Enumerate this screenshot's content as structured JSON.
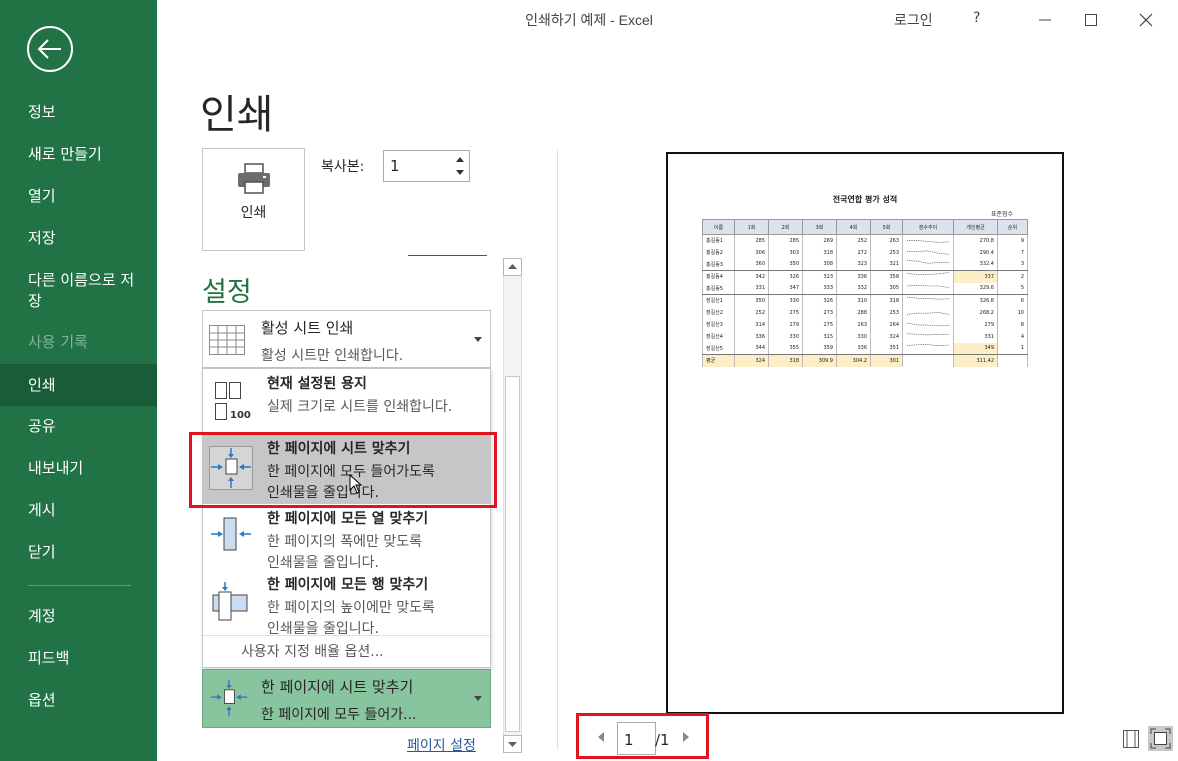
{
  "window": {
    "title": "인쇄하기 예제  -  Excel",
    "login_label": "로그인",
    "help_label": "?"
  },
  "sidebar": {
    "items": [
      {
        "label": "정보"
      },
      {
        "label": "새로 만들기"
      },
      {
        "label": "열기"
      },
      {
        "label": "저장"
      },
      {
        "label": "다른 이름으로 저장"
      },
      {
        "label": "사용 기록"
      },
      {
        "label": "인쇄"
      },
      {
        "label": "공유"
      },
      {
        "label": "내보내기"
      },
      {
        "label": "게시"
      },
      {
        "label": "닫기"
      },
      {
        "label": "계정"
      },
      {
        "label": "피드백"
      },
      {
        "label": "옵션"
      }
    ]
  },
  "print": {
    "heading": "인쇄",
    "button_label": "인쇄",
    "copies_label": "복사본:",
    "copies_value": "1"
  },
  "settings": {
    "heading": "설정",
    "sheet_dropdown": {
      "main": "활성 시트 인쇄",
      "sub": "활성 시트만 인쇄합니다."
    },
    "menu": {
      "items": [
        {
          "title": "현재 설정된 용지",
          "desc1": "실제 크기로 시트를 인쇄합니다.",
          "desc2": "",
          "icon_label": "100"
        },
        {
          "title": "한 페이지에 시트 맞추기",
          "desc1": "한 페이지에 모두 들어가도록",
          "desc2": "인쇄물을 줄입니다."
        },
        {
          "title": "한 페이지에 모든 열 맞추기",
          "desc1": "한 페이지의 폭에만 맞도록",
          "desc2": "인쇄물을 줄입니다."
        },
        {
          "title": "한 페이지에 모든 행 맞추기",
          "desc1": "한 페이지의 높이에만 맞도록",
          "desc2": "인쇄물을 줄입니다."
        }
      ],
      "custom_label": "사용자 지정 배율 옵션..."
    },
    "scale_dropdown": {
      "main": "한 페이지에 시트 맞추기",
      "sub": "한 페이지에 모두 들어가..."
    },
    "page_setup_link": "페이지 설정"
  },
  "preview": {
    "title": "전국연합 평가 성적",
    "unit_label": "표준점수",
    "headers": [
      "이름",
      "1회",
      "2회",
      "3회",
      "4회",
      "5회",
      "점수추이",
      "개인평균",
      "순위"
    ],
    "rows": [
      {
        "name": "홍길동1",
        "s1": "285",
        "s2": "285",
        "s3": "269",
        "s4": "252",
        "s5": "263",
        "avg": "270.8",
        "rank": "9"
      },
      {
        "name": "홍길동2",
        "s1": "306",
        "s2": "303",
        "s3": "318",
        "s4": "272",
        "s5": "253",
        "avg": "290.4",
        "rank": "7"
      },
      {
        "name": "홍길동3",
        "s1": "360",
        "s2": "350",
        "s3": "308",
        "s4": "323",
        "s5": "321",
        "avg": "332.4",
        "rank": "3"
      },
      {
        "name": "홍길동4",
        "s1": "342",
        "s2": "326",
        "s3": "323",
        "s4": "336",
        "s5": "358",
        "avg": "337",
        "rank": "2"
      },
      {
        "name": "홍길동5",
        "s1": "331",
        "s2": "347",
        "s3": "333",
        "s4": "332",
        "s5": "305",
        "avg": "329.6",
        "rank": "5"
      },
      {
        "name": "장길산1",
        "s1": "350",
        "s2": "330",
        "s3": "326",
        "s4": "310",
        "s5": "318",
        "avg": "326.8",
        "rank": "6"
      },
      {
        "name": "장길산2",
        "s1": "252",
        "s2": "275",
        "s3": "273",
        "s4": "288",
        "s5": "253",
        "avg": "268.2",
        "rank": "10"
      },
      {
        "name": "장길산3",
        "s1": "314",
        "s2": "279",
        "s3": "275",
        "s4": "263",
        "s5": "264",
        "avg": "279",
        "rank": "8"
      },
      {
        "name": "장길산4",
        "s1": "336",
        "s2": "330",
        "s3": "315",
        "s4": "330",
        "s5": "324",
        "avg": "331",
        "rank": "4"
      },
      {
        "name": "장길산5",
        "s1": "344",
        "s2": "355",
        "s3": "359",
        "s4": "336",
        "s5": "351",
        "avg": "349",
        "rank": "1"
      }
    ],
    "avg_row": {
      "name": "평균",
      "s1": "324",
      "s2": "318",
      "s3": "309.9",
      "s4": "304.2",
      "s5": "301",
      "avg": "311.42"
    },
    "highlight_color": "#fcefc7"
  },
  "page_nav": {
    "current": "1",
    "total": "/1"
  },
  "colors": {
    "brand_green": "#217346",
    "active_nav": "#1a5c38",
    "selected_option": "#88c49e",
    "callout_red": "#e0141e",
    "link_blue": "#2b579a"
  }
}
